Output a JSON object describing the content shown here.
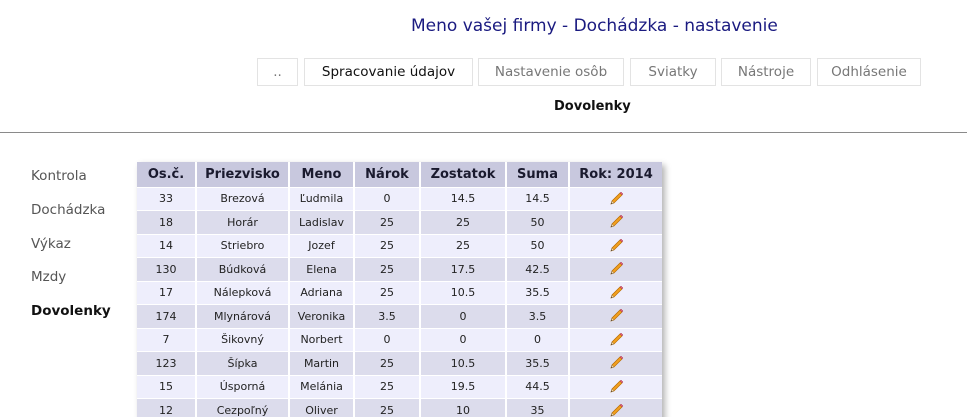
{
  "header": {
    "title": "Meno vašej firmy - Dochádzka - nastavenie"
  },
  "nav": [
    {
      "label": "..",
      "active": false
    },
    {
      "label": "Spracovanie údajov",
      "active": true
    },
    {
      "label": "Nastavenie osôb",
      "active": false
    },
    {
      "label": "Sviatky",
      "active": false
    },
    {
      "label": "Nástroje",
      "active": false
    },
    {
      "label": "Odhlásenie",
      "active": false
    }
  ],
  "subnav": {
    "label": "Dovolenky"
  },
  "sidebar": [
    {
      "label": "Kontrola",
      "active": false
    },
    {
      "label": "Dochádzka",
      "active": false
    },
    {
      "label": "Výkaz",
      "active": false
    },
    {
      "label": "Mzdy",
      "active": false
    },
    {
      "label": "Dovolenky",
      "active": true
    }
  ],
  "table": {
    "headers": [
      "Os.č.",
      "Priezvisko",
      "Meno",
      "Nárok",
      "Zostatok",
      "Suma",
      "Rok: 2014"
    ],
    "rows": [
      [
        "33",
        "Brezová",
        "Ľudmila",
        "0",
        "14.5",
        "14.5"
      ],
      [
        "18",
        "Horár",
        "Ladislav",
        "25",
        "25",
        "50"
      ],
      [
        "14",
        "Striebro",
        "Jozef",
        "25",
        "25",
        "50"
      ],
      [
        "130",
        "Búdková",
        "Elena",
        "25",
        "17.5",
        "42.5"
      ],
      [
        "17",
        "Nálepková",
        "Adriana",
        "25",
        "10.5",
        "35.5"
      ],
      [
        "174",
        "Mlynárová",
        "Veronika",
        "3.5",
        "0",
        "3.5"
      ],
      [
        "7",
        "Šikovný",
        "Norbert",
        "0",
        "0",
        "0"
      ],
      [
        "123",
        "Šípka",
        "Martin",
        "25",
        "10.5",
        "35.5"
      ],
      [
        "15",
        "Úsporná",
        "Melánia",
        "25",
        "19.5",
        "44.5"
      ],
      [
        "12",
        "Cezpoľný",
        "Oliver",
        "25",
        "10",
        "35"
      ]
    ],
    "action_icon": "pencil-icon"
  },
  "colors": {
    "title": "#1a1a80",
    "header_bg": "#c8c8de",
    "row_odd": "#eeeefc",
    "row_even": "#dcdcec"
  }
}
